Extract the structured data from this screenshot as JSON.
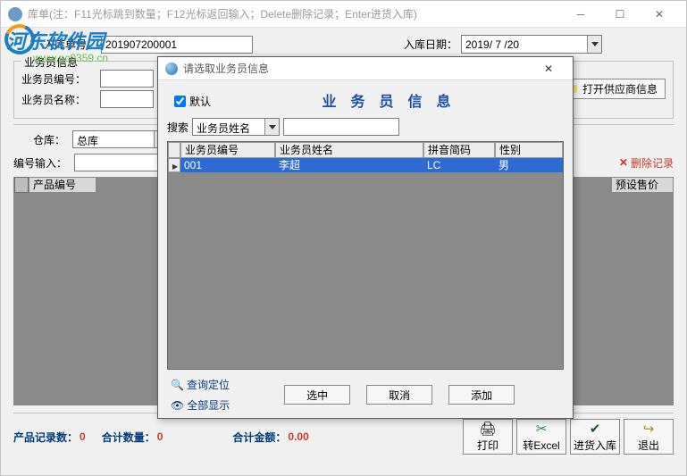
{
  "main": {
    "title": "库单(注：F11光标跳到数量；F12光标返回输入；Delete删除记录；Enter进货入库)",
    "order_no_label": "入库单号：",
    "order_no": "201907200001",
    "date_label": "入库日期：",
    "date_value": "2019/ 7 /20",
    "fieldset_title": "业务员信息",
    "sales_code_label": "业务员编号：",
    "sales_code": "",
    "sales_name_label": "业务员名称：",
    "sales_name": "",
    "open_supplier_btn": "打开供应商信息",
    "warehouse_label": "仓库：",
    "warehouse_value": "总库",
    "code_input_label": "编号输入：",
    "code_input": "",
    "delete_record": "删除记录",
    "columns": {
      "product_code": "产品编号",
      "preset_price": "预设售价"
    },
    "status": {
      "record_count_label": "产品记录数：",
      "record_count": "0",
      "total_qty_label": "合计数量：",
      "total_qty": "0",
      "total_amt_label": "合计金额：",
      "total_amt": "0.00"
    },
    "buttons": {
      "print": "打印",
      "excel": "转Excel",
      "stockin": "进货入库",
      "exit": "退出"
    }
  },
  "watermark": {
    "line1": "河东软件园",
    "line2": "www.pc0359.cn"
  },
  "dialog": {
    "title": "请选取业务员信息",
    "default_label": "默认",
    "heading": "业务员信息",
    "search_label": "搜索",
    "search_field": "业务员姓名",
    "search_value": "",
    "columns": {
      "code": "业务员编号",
      "name": "业务员姓名",
      "pinyin": "拼音简码",
      "gender": "性别"
    },
    "rows": [
      {
        "code": "001",
        "name": "李超",
        "pinyin": "LC",
        "gender": "男"
      }
    ],
    "actions": {
      "locate": "查询定位",
      "show_all": "全部显示",
      "select": "选中",
      "cancel": "取消",
      "add": "添加"
    }
  }
}
